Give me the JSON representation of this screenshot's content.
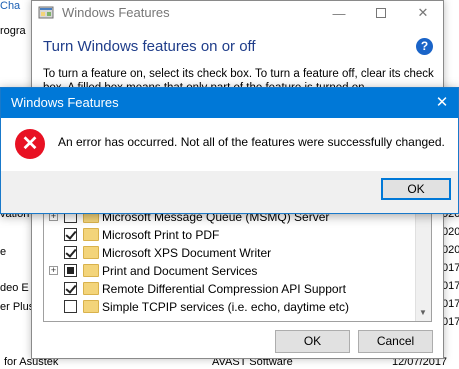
{
  "background": {
    "left_fragments": [
      "Cha",
      "rogra",
      "vation",
      "e",
      "deo E",
      "er Plus"
    ],
    "right_fragments": [
      "020",
      "020",
      "020",
      "017",
      "017",
      "017",
      "017"
    ],
    "bottom_row": {
      "name": "for Asustek",
      "publisher": "AVAST Software",
      "date": "12/07/2017"
    }
  },
  "features_window": {
    "title": "Windows Features",
    "heading": "Turn Windows features on or off",
    "help_icon": "?",
    "description": "To turn a feature on, select its check box. To turn a feature off, clear its check box. A filled box means that only part of the feature is turned on.",
    "tree": [
      {
        "label": "Microsoft Message Queue (MSMQ) Server",
        "state": "unchecked",
        "expandable": true
      },
      {
        "label": "Microsoft Print to PDF",
        "state": "checked",
        "expandable": false
      },
      {
        "label": "Microsoft XPS Document Writer",
        "state": "checked",
        "expandable": false
      },
      {
        "label": "Print and Document Services",
        "state": "partial",
        "expandable": true
      },
      {
        "label": "Remote Differential Compression API Support",
        "state": "checked",
        "expandable": false
      },
      {
        "label": "Simple TCPIP services (i.e. echo, daytime etc)",
        "state": "unchecked",
        "expandable": false
      }
    ],
    "ok_label": "OK",
    "cancel_label": "Cancel"
  },
  "error_dialog": {
    "title": "Windows Features",
    "close_glyph": "✕",
    "icon_glyph": "✕",
    "message": "An error has occurred. Not all of the features were successfully changed.",
    "ok_label": "OK"
  },
  "colors": {
    "accent": "#0078d7",
    "heading": "#1f3d8a",
    "error": "#e81123"
  }
}
